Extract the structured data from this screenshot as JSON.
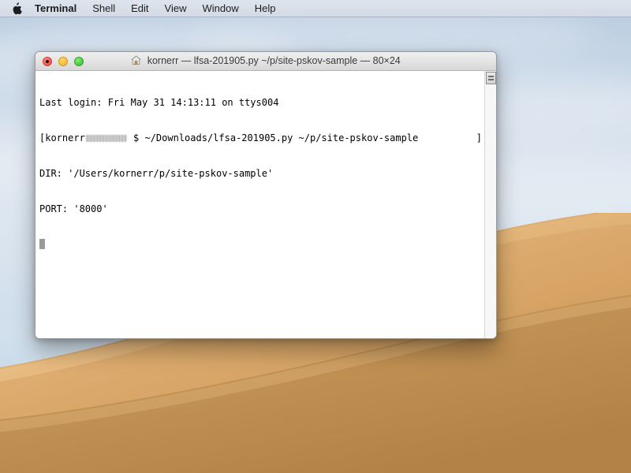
{
  "menubar": {
    "apple_icon": "apple-logo",
    "items": [
      {
        "label": "Terminal",
        "bold": true
      },
      {
        "label": "Shell",
        "bold": false
      },
      {
        "label": "Edit",
        "bold": false
      },
      {
        "label": "View",
        "bold": false
      },
      {
        "label": "Window",
        "bold": false
      },
      {
        "label": "Help",
        "bold": false
      }
    ]
  },
  "window": {
    "proxy_icon": "home-folder-icon",
    "title": "kornerr — lfsa-201905.py ~/p/site-pskov-sample — 80×24",
    "traffic_lights": {
      "close": "close-button",
      "minimize": "minimize-button",
      "zoom": "zoom-button"
    },
    "columns": "80",
    "rows": "24"
  },
  "terminal": {
    "line1": "Last login: Fri May 31 14:13:11 on ttys004",
    "line2_prompt_open": "[kornerr",
    "line2_redacted": "",
    "line2_command": " $ ~/Downloads/lfsa-201905.py ~/p/site-pskov-sample",
    "line2_bracket_close": "]",
    "line3": "DIR: '/Users/kornerr/p/site-pskov-sample'",
    "line4": "PORT: '8000'",
    "cursor": "block-cursor"
  },
  "scrollbar": {
    "thumb": "scrollbar-thumb"
  },
  "colors": {
    "menubar_bg": "#d6dde8",
    "titlebar_bg": "#e4e4e4",
    "terminal_bg": "#ffffff",
    "terminal_fg": "#000000",
    "close_red": "#ef5349",
    "minimize_yellow": "#f1bc34",
    "zoom_green": "#45c83d",
    "cursor_grey": "#9a9a9a",
    "dune_sand": "#d9a96a",
    "sky_blue": "#cfdcea"
  }
}
